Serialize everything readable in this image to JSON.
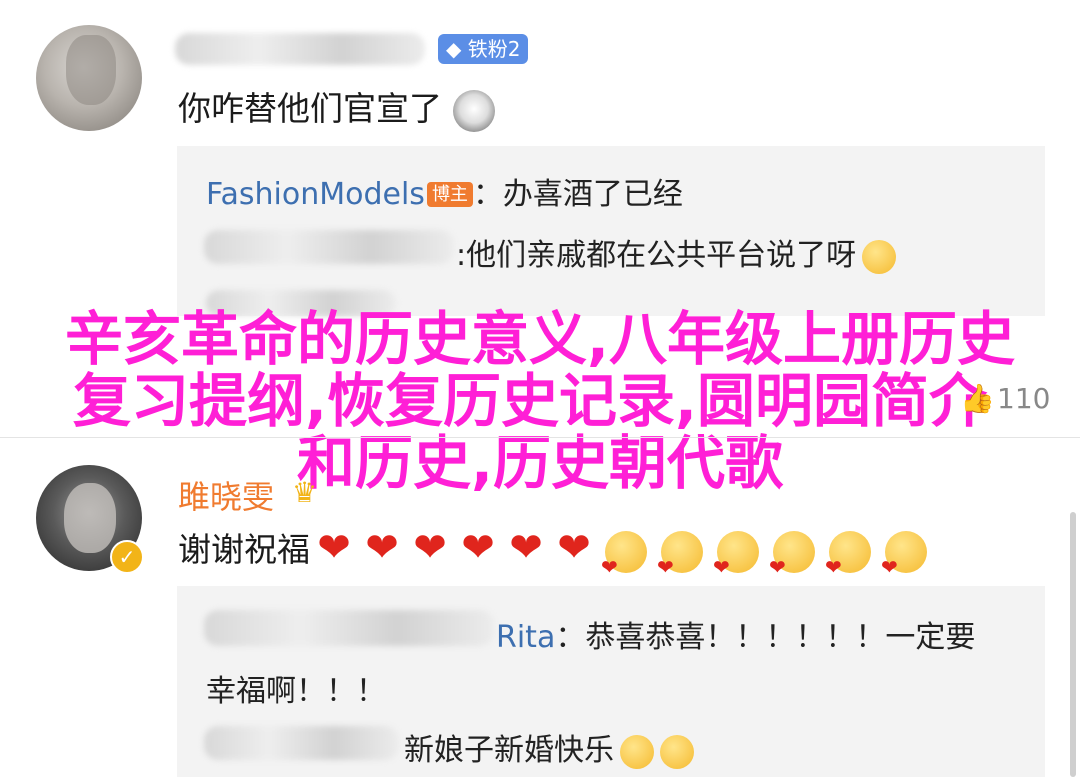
{
  "comment1": {
    "badge": "铁粉2",
    "text": "你咋替他们官宣了",
    "replies": [
      {
        "user": "FashionModels",
        "badge": "博主",
        "text": "：办喜酒了已经"
      },
      {
        "text": "他们亲戚都在公共平台说了呀"
      }
    ]
  },
  "footer_count": "110",
  "overlay": {
    "line1": "辛亥革命的历史意义,八年级上册历史",
    "line2": "复习提纲,恢复历史记录,圆明园简介",
    "line3": "和历史,历史朝代歌"
  },
  "comment2": {
    "user": "雎晓雯",
    "text": "谢谢祝福",
    "hearts": [
      "❤",
      "❤",
      "❤",
      "❤",
      "❤",
      "❤"
    ],
    "replies": [
      {
        "user_tail": "Rita",
        "text": "：恭喜恭喜！！！！！！一定要",
        "text2": "幸福啊！！！"
      },
      {
        "text": "新娘子新婚快乐"
      }
    ]
  }
}
